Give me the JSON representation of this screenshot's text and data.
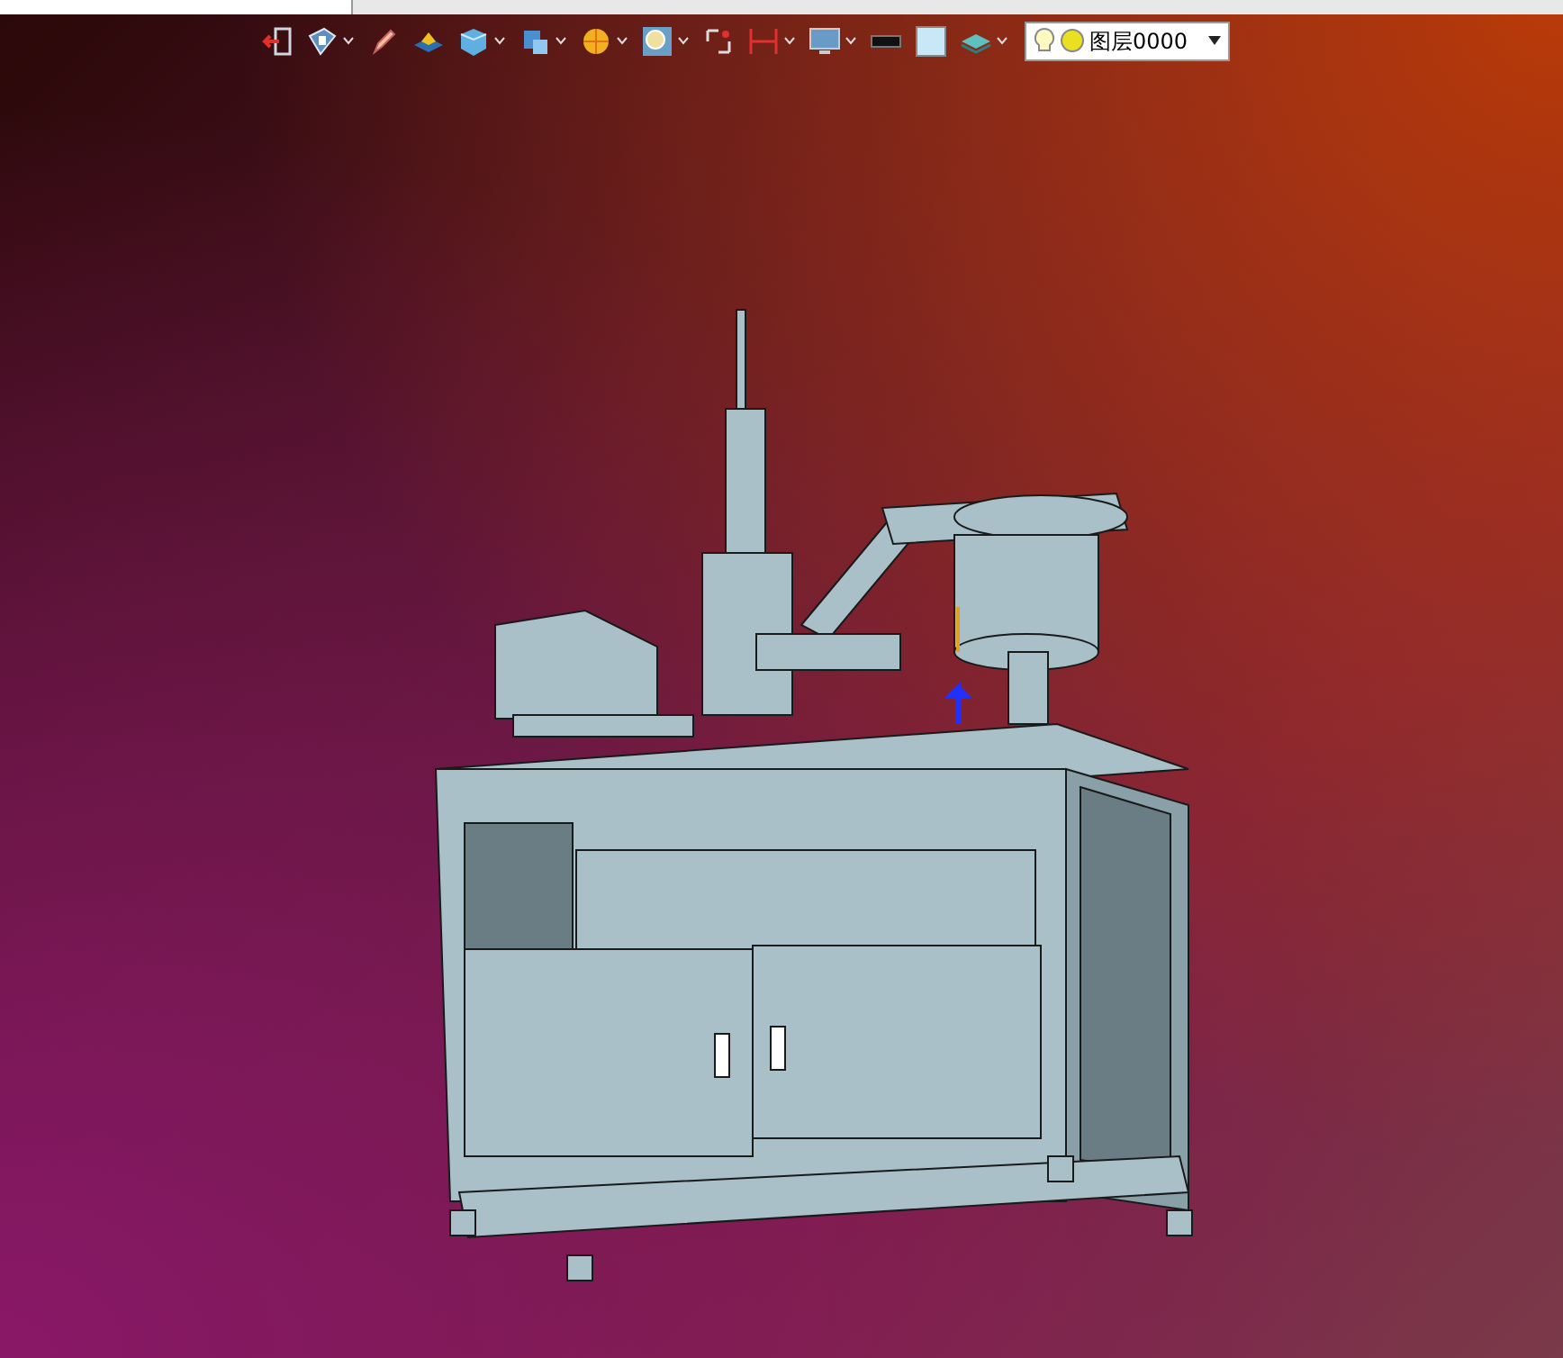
{
  "toolbar": {
    "items": [
      {
        "kind": "exit",
        "dropdown": false
      },
      {
        "kind": "view",
        "dropdown": true
      },
      {
        "kind": "pencil",
        "dropdown": false
      },
      {
        "kind": "plane",
        "dropdown": false
      },
      {
        "kind": "cube",
        "dropdown": true
      },
      {
        "kind": "box",
        "dropdown": true
      },
      {
        "kind": "ball",
        "dropdown": true
      },
      {
        "kind": "zoom",
        "dropdown": true
      },
      {
        "kind": "pick",
        "dropdown": false
      },
      {
        "kind": "measure",
        "dropdown": true
      },
      {
        "kind": "monitor",
        "dropdown": true
      },
      {
        "kind": "line",
        "dropdown": false
      },
      {
        "kind": "fill",
        "dropdown": false
      },
      {
        "kind": "layers",
        "dropdown": true
      }
    ]
  },
  "layer_selector": {
    "value": "图层0000"
  }
}
